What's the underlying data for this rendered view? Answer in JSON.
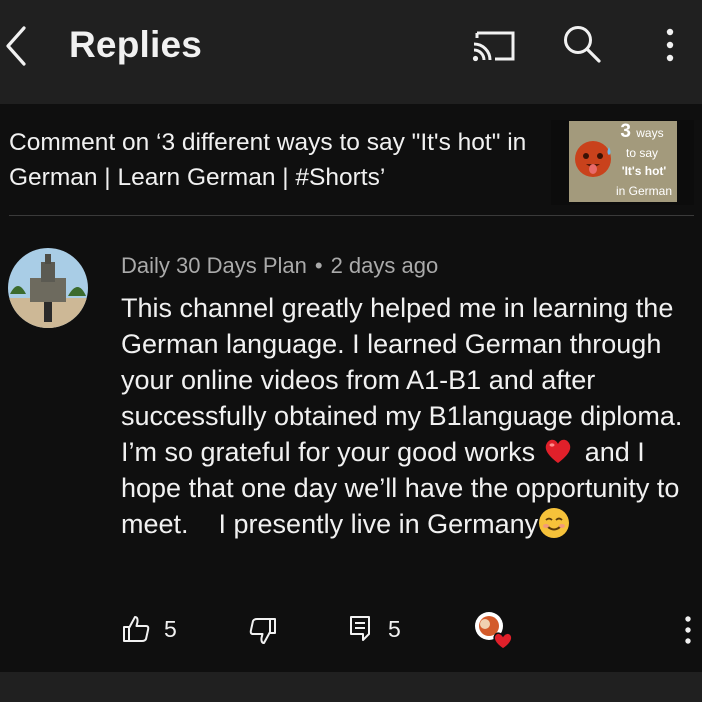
{
  "header": {
    "title": "Replies",
    "icons": [
      "back-icon",
      "cast-icon",
      "search-icon",
      "more-vert-icon"
    ]
  },
  "context": {
    "text": "Comment on ‘3 different ways to say \"It's hot\" in German | Learn German | #Shorts’",
    "thumbnail": {
      "line1": "3",
      "line1b": "ways",
      "line2": "to say",
      "line3": "'It's hot'",
      "line4": "in German"
    }
  },
  "comment": {
    "author": "Daily 30 Days Plan",
    "separator": "•",
    "time": "2 days ago",
    "body_part1": "This channel greatly helped me in learning the German language. I learned German through your online videos from A1-B1 and after successfully obtained my B1language diploma. I’m so grateful for your good works",
    "body_part2": "and I hope that one day we’ll have the opportunity to meet.",
    "body_part3": "I presently live in Germany",
    "emojis": [
      "red-heart-emoji",
      "smiling-face-emoji"
    ],
    "likes": "5",
    "replies": "5",
    "colors": {
      "heart": "#e0202a",
      "background": "#0f0f0f",
      "header": "#202020",
      "meta": "#aaaaaa"
    }
  }
}
